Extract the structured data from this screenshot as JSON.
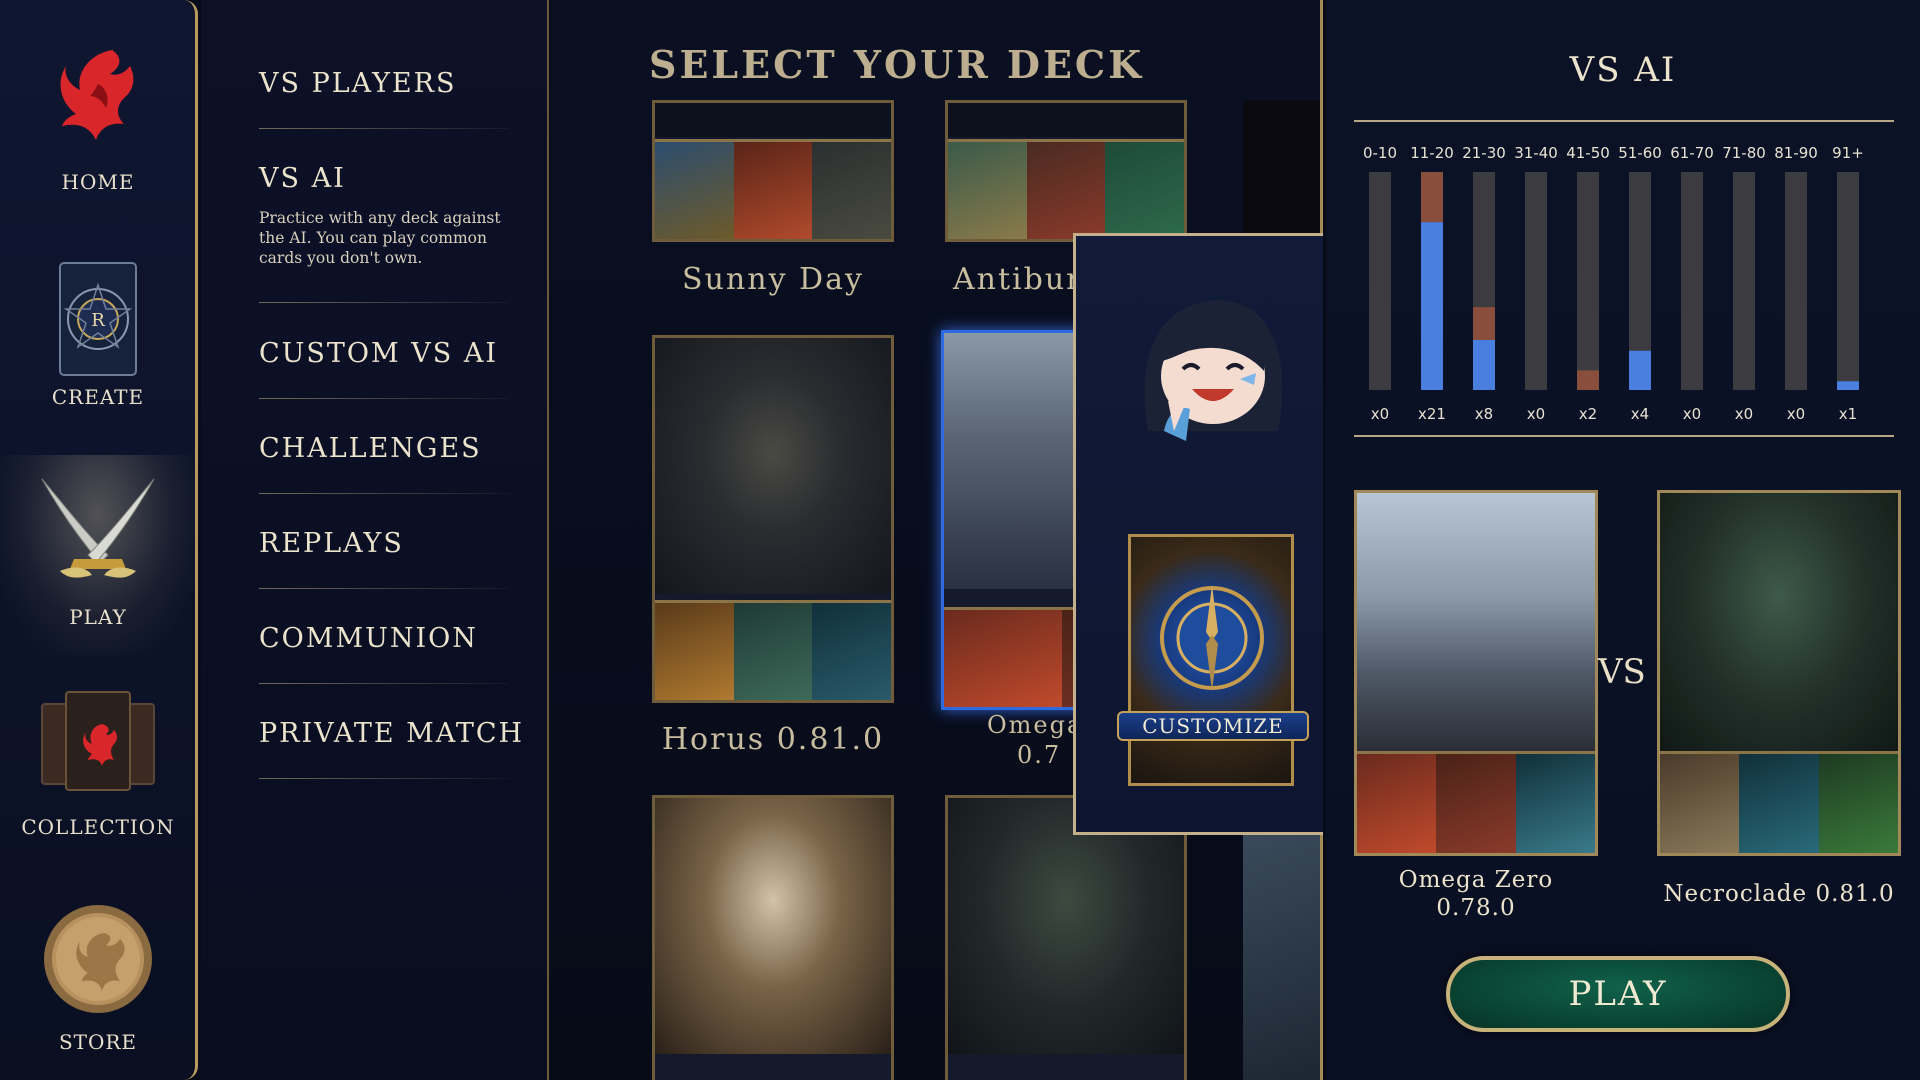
{
  "nav": {
    "items": [
      {
        "label": "HOME",
        "icon": "phoenix-logo-icon"
      },
      {
        "label": "CREATE",
        "icon": "sigil-card-icon"
      },
      {
        "label": "PLAY",
        "icon": "crossed-blades-icon",
        "active": true
      },
      {
        "label": "COLLECTION",
        "icon": "card-stack-icon"
      },
      {
        "label": "STORE",
        "icon": "gold-coin-icon"
      }
    ]
  },
  "modes": {
    "items": [
      {
        "label": "VS PLAYERS"
      },
      {
        "label": "VS AI",
        "description": "Practice with any deck against the AI. You can play common cards you don't own."
      },
      {
        "label": "CUSTOM VS AI"
      },
      {
        "label": "CHALLENGES"
      },
      {
        "label": "REPLAYS"
      },
      {
        "label": "COMMUNION"
      },
      {
        "label": "PRIVATE MATCH"
      }
    ]
  },
  "decks": {
    "title": "SELECT YOUR DECK",
    "items": [
      {
        "name": "Sunny Day"
      },
      {
        "name": "Antibur"
      },
      {
        "name": "Horus 0.81.0"
      },
      {
        "name": "Omega",
        "name_line2": "0.7",
        "selected": true
      }
    ]
  },
  "popup": {
    "customize_label": "CUSTOMIZE"
  },
  "vs_panel": {
    "title": "VS AI",
    "vs_label": "VS",
    "player_deck": {
      "name": "Omega Zero",
      "version": "0.78.0"
    },
    "opponent_deck": {
      "name": "Necroclade 0.81.0"
    },
    "play_label": "PLAY"
  },
  "chart_data": {
    "type": "bar",
    "categories": [
      "0-10",
      "11-20",
      "21-30",
      "31-40",
      "41-50",
      "51-60",
      "61-70",
      "71-80",
      "81-90",
      "91+"
    ],
    "count_labels": [
      "x0",
      "x21",
      "x8",
      "x0",
      "x2",
      "x4",
      "x0",
      "x0",
      "x0",
      "x1"
    ],
    "series": [
      {
        "values": [
          0,
          0.77,
          0.23,
          0,
          0,
          0.18,
          0,
          0,
          0,
          0.04
        ],
        "color": "#4a7fe0"
      },
      {
        "values": [
          0,
          0.23,
          0.15,
          0,
          0.09,
          0,
          0,
          0,
          0,
          0
        ],
        "color": "#8a4f3c"
      }
    ],
    "ylim": [
      0,
      1
    ],
    "track_color": "#3b3b40"
  }
}
